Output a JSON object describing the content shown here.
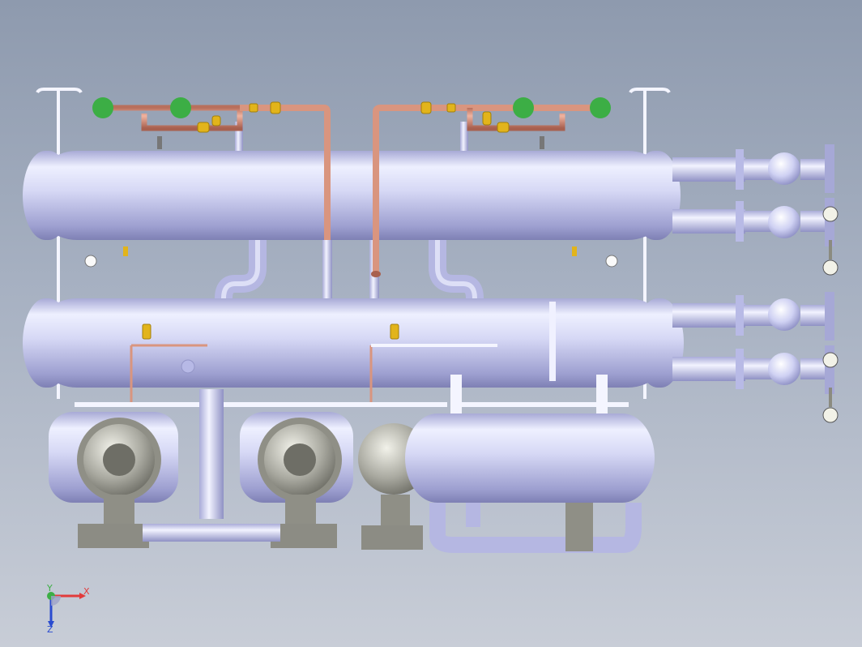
{
  "model_view": {
    "background_top": "#8e9aae",
    "background_bottom": "#c8cdd7",
    "vessel_color": "#c9cbef",
    "copper_pipe_color": "#d9957f",
    "valve_color": "#e2b41b",
    "sight_glass_color": "#3cae45",
    "compressor_color": "#9a9a92"
  },
  "triad": {
    "x_label": "X",
    "y_label": "Y",
    "z_label": "Z",
    "x_color": "#e23b3b",
    "y_color": "#3cae45",
    "z_color": "#2a4bd0"
  }
}
